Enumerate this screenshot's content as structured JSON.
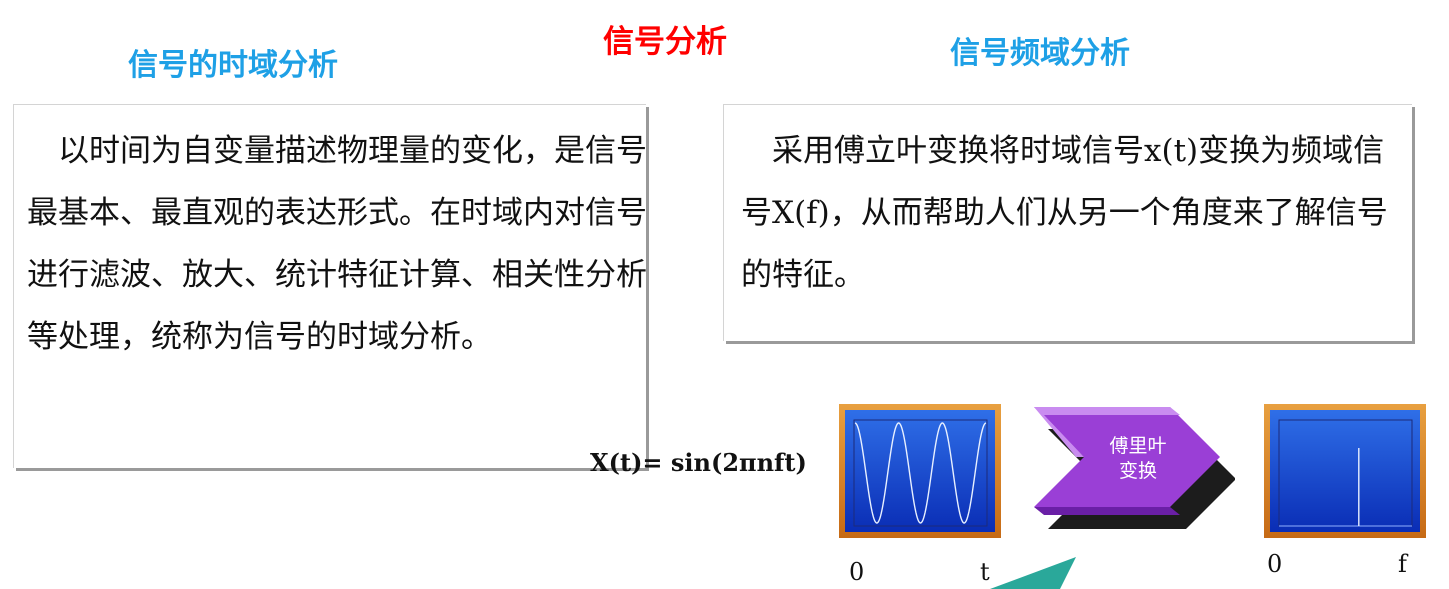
{
  "title": {
    "text": "信号分析",
    "color": "#ff0000"
  },
  "left": {
    "heading": "信号的时域分析",
    "heading_color": "#1ea0e6",
    "body": "以时间为自变量描述物理量的变化，是信号最基本、最直观的表达形式。在时域内对信号进行滤波、放大、统计特征计算、相关性分析等处理，统称为信号的时域分析。"
  },
  "right": {
    "heading": "信号频域分析",
    "heading_color": "#1ea0e6",
    "body": "采用傅立叶变换将时域信号x(t)变换为频域信号X(f)，从而帮助人们从另一个角度来了解信号的特征。"
  },
  "diagram": {
    "formula": "X(t)= sin(2πnft)",
    "time_plot": {
      "x_start_label": "0",
      "x_end_label": "t",
      "waveform": "sine",
      "cycles": 3
    },
    "transform_label_line1": "傅里叶",
    "transform_label_line2": "变换",
    "freq_plot": {
      "x_start_label": "0",
      "x_end_label": "f",
      "spike_position_fraction": 0.6
    },
    "frame_color": "#e08c2a",
    "plot_bg_color": "#1a44c8",
    "arrow_color": "#9a3fd6",
    "arrow_shadow_color": "#1c1c1c",
    "accent_color": "#2aa89a"
  }
}
